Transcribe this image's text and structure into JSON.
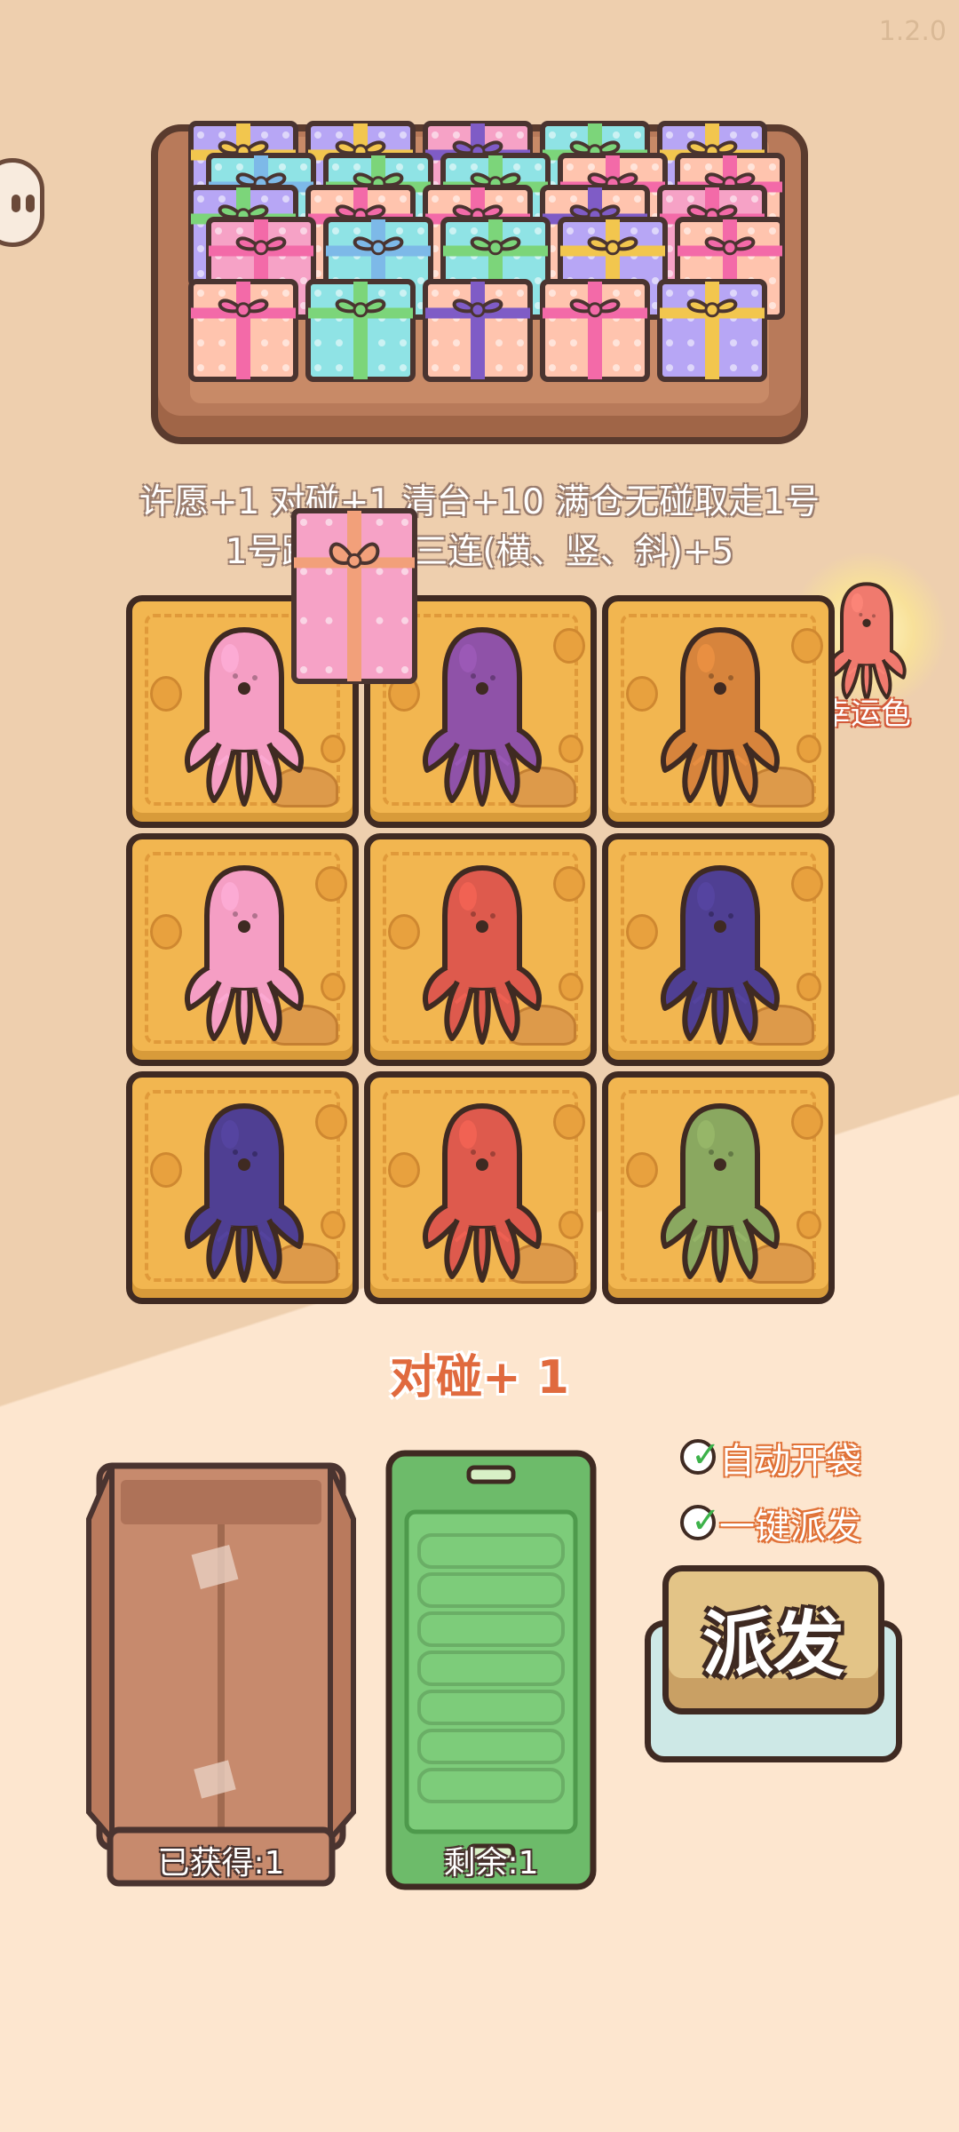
{
  "version": "1.2.0",
  "rules": {
    "line1": "许愿+1 对碰+1 清台+10 满仓无碰取走1号",
    "line2": "1号踩点+3 三连(横、竖、斜)+5"
  },
  "lucky": {
    "label": "幸运色",
    "color": "#f07a6e"
  },
  "grid": [
    [
      {
        "color": "#f59ec4"
      },
      {
        "color": "#8f52a8"
      },
      {
        "color": "#d7843c"
      }
    ],
    [
      {
        "color": "#f59ec4"
      },
      {
        "color": "#de5a4d"
      },
      {
        "color": "#4f3f93"
      }
    ],
    [
      {
        "color": "#4f3f93"
      },
      {
        "color": "#de5a4d"
      },
      {
        "color": "#8aa860"
      }
    ]
  ],
  "tray_gifts": [
    {
      "col": 0,
      "row": 0,
      "box": "#b7a6f5",
      "ribbon": "#f2c64e"
    },
    {
      "col": 1,
      "row": 0,
      "box": "#b7a6f5",
      "ribbon": "#f2c64e"
    },
    {
      "col": 2,
      "row": 0,
      "box": "#f6a2c6",
      "ribbon": "#7f5cc6"
    },
    {
      "col": 3,
      "row": 0,
      "box": "#8fe3e5",
      "ribbon": "#7cd57a"
    },
    {
      "col": 4,
      "row": 0,
      "box": "#b7a6f5",
      "ribbon": "#f2c64e"
    },
    {
      "col": 0,
      "row": 1,
      "box": "#8fe3e5",
      "ribbon": "#7db9e8"
    },
    {
      "col": 1,
      "row": 1,
      "box": "#8fe3e5",
      "ribbon": "#7cd57a"
    },
    {
      "col": 2,
      "row": 1,
      "box": "#8fe3e5",
      "ribbon": "#7cd57a"
    },
    {
      "col": 3,
      "row": 1,
      "box": "#ffc4ae",
      "ribbon": "#f36aa8"
    },
    {
      "col": 4,
      "row": 1,
      "box": "#ffc4ae",
      "ribbon": "#f36aa8"
    },
    {
      "col": 0,
      "row": 2,
      "box": "#b7a6f5",
      "ribbon": "#7cd57a"
    },
    {
      "col": 1,
      "row": 2,
      "box": "#ffc4ae",
      "ribbon": "#f36aa8"
    },
    {
      "col": 2,
      "row": 2,
      "box": "#ffc4ae",
      "ribbon": "#f36aa8"
    },
    {
      "col": 3,
      "row": 2,
      "box": "#ffc4ae",
      "ribbon": "#7f5cc6"
    },
    {
      "col": 4,
      "row": 2,
      "box": "#f6a2c6",
      "ribbon": "#f36aa8"
    },
    {
      "col": 0,
      "row": 3,
      "box": "#f6a2c6",
      "ribbon": "#f36aa8"
    },
    {
      "col": 1,
      "row": 3,
      "box": "#8fe3e5",
      "ribbon": "#7db9e8"
    },
    {
      "col": 2,
      "row": 3,
      "box": "#8fe3e5",
      "ribbon": "#7cd57a"
    },
    {
      "col": 3,
      "row": 3,
      "box": "#b7a6f5",
      "ribbon": "#f2c64e"
    },
    {
      "col": 4,
      "row": 3,
      "box": "#ffc4ae",
      "ribbon": "#f36aa8"
    },
    {
      "col": 0,
      "row": 4,
      "box": "#ffc4ae",
      "ribbon": "#f36aa8"
    },
    {
      "col": 1,
      "row": 4,
      "box": "#8fe3e5",
      "ribbon": "#7cd57a"
    },
    {
      "col": 2,
      "row": 4,
      "box": "#ffc4ae",
      "ribbon": "#7f5cc6"
    },
    {
      "col": 3,
      "row": 4,
      "box": "#ffc4ae",
      "ribbon": "#f36aa8"
    },
    {
      "col": 4,
      "row": 4,
      "box": "#b7a6f5",
      "ribbon": "#f2c64e"
    }
  ],
  "floating_gift": {
    "box": "#f6a2c6",
    "ribbon": "#f2a07a"
  },
  "pair_text": "对碰+ 1",
  "options": {
    "auto_open": {
      "label": "自动开袋",
      "checked": true
    },
    "one_key": {
      "label": "一键派发",
      "checked": true
    }
  },
  "obtained": {
    "label": "已获得:1"
  },
  "remaining": {
    "label": "剩余:1"
  },
  "dispatch": {
    "label": "派发"
  }
}
